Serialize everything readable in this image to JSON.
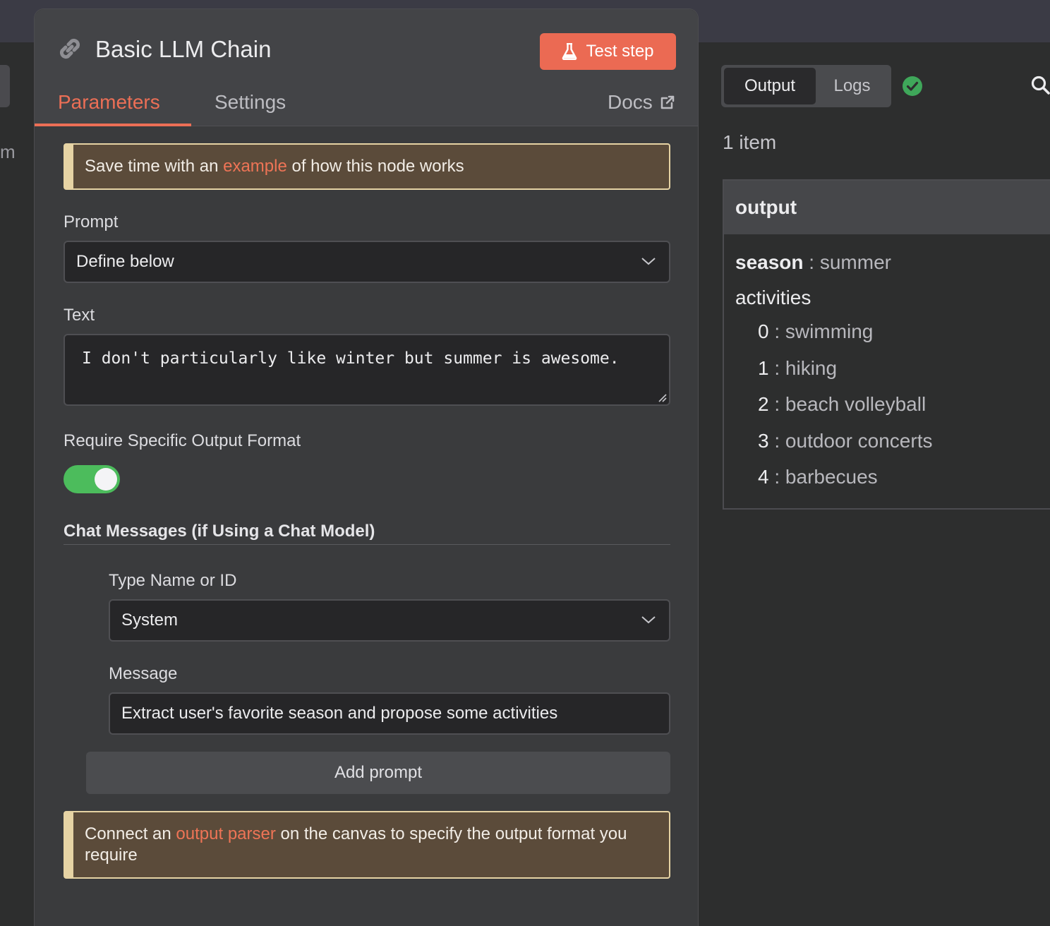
{
  "node": {
    "title": "Basic LLM Chain",
    "test_button": "Test step",
    "tabs": {
      "parameters": "Parameters",
      "settings": "Settings",
      "docs": "Docs"
    }
  },
  "left_edge_text": "m",
  "callout_example": {
    "before": "Save time with an ",
    "link": "example",
    "after": " of how this node works"
  },
  "prompt": {
    "label": "Prompt",
    "value": "Define below"
  },
  "text": {
    "label": "Text",
    "value": "I don't particularly like winter but summer is awesome."
  },
  "output_format": {
    "label": "Require Specific Output Format",
    "enabled": true
  },
  "chat_messages": {
    "title": "Chat Messages (if Using a Chat Model)",
    "type_label": "Type Name or ID",
    "type_value": "System",
    "message_label": "Message",
    "message_value": "Extract user's favorite season and propose some activities",
    "add_button": "Add prompt"
  },
  "callout_parser": {
    "before": "Connect an ",
    "link": "output parser",
    "after": " on the canvas to specify the output format you require"
  },
  "output_panel": {
    "tabs": {
      "output": "Output",
      "logs": "Logs"
    },
    "item_count": "1 item",
    "header": "output",
    "season_key": "season",
    "season_sep": " : ",
    "season_value": "summer",
    "activities_key": "activities",
    "activities": [
      {
        "index": "0",
        "value": "swimming"
      },
      {
        "index": "1",
        "value": "hiking"
      },
      {
        "index": "2",
        "value": "beach volleyball"
      },
      {
        "index": "3",
        "value": "outdoor concerts"
      },
      {
        "index": "4",
        "value": "barbecues"
      }
    ]
  },
  "colors": {
    "accent": "#ec6f56",
    "toggle_on": "#4cbc5c",
    "success": "#3fa75a",
    "callout_border": "#e6d3a4"
  }
}
